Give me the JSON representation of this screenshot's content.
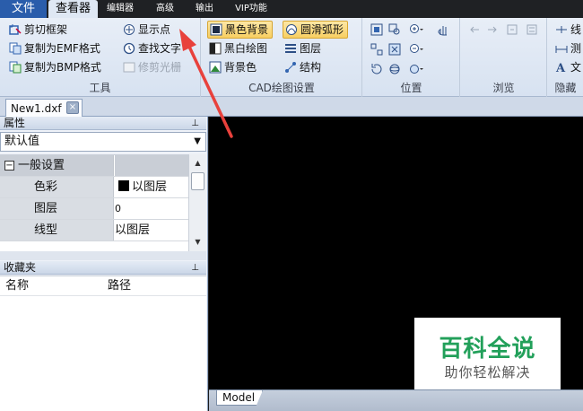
{
  "menubar": {
    "tabs": [
      {
        "label": "文件"
      },
      {
        "label": "查看器"
      },
      {
        "label": "编辑器"
      },
      {
        "label": "高级"
      },
      {
        "label": "输出"
      },
      {
        "label": "VIP功能"
      }
    ]
  },
  "ribbon": {
    "tools": {
      "label": "工具",
      "crop_frame": "剪切框架",
      "copy_emf": "复制为EMF格式",
      "copy_bmp": "复制为BMP格式",
      "show_points": "显示点",
      "find_text": "查找文字",
      "trim_raster": "修剪光栅"
    },
    "cad_settings": {
      "label": "CAD绘图设置",
      "black_bg": "黑色背景",
      "smooth_arc": "圆滑弧形",
      "bw_draw": "黑白绘图",
      "layers": "图层",
      "bg_color": "背景色",
      "structure": "结构"
    },
    "position": {
      "label": "位置"
    },
    "browse": {
      "label": "浏览"
    },
    "hidden": {
      "label": "隐藏",
      "line": "线",
      "measure": "测",
      "text": "文"
    }
  },
  "document": {
    "tab_label": "New1.dxf",
    "close_glyph": "×"
  },
  "properties": {
    "title": "属性",
    "pin_glyph": "ᵖ",
    "combo_value": "默认值",
    "category": "一般设置",
    "expander": "−",
    "rows": [
      {
        "key": "色彩",
        "value": "以图层",
        "swatch": "#000000"
      },
      {
        "key": "图层",
        "value": "0"
      },
      {
        "key": "线型",
        "value": "以图层"
      }
    ]
  },
  "favorites": {
    "title": "收藏夹",
    "col_name": "名称",
    "col_path": "路径"
  },
  "canvas": {
    "model_tab": "Model",
    "background": "#000000"
  },
  "watermark": {
    "title": "百科全说",
    "subtitle": "助你轻松解决"
  },
  "colors": {
    "accent": "#2a5dab",
    "highlight": "#f8cf62",
    "arrow": "#e8413c",
    "watermark_green": "#22a05a"
  }
}
